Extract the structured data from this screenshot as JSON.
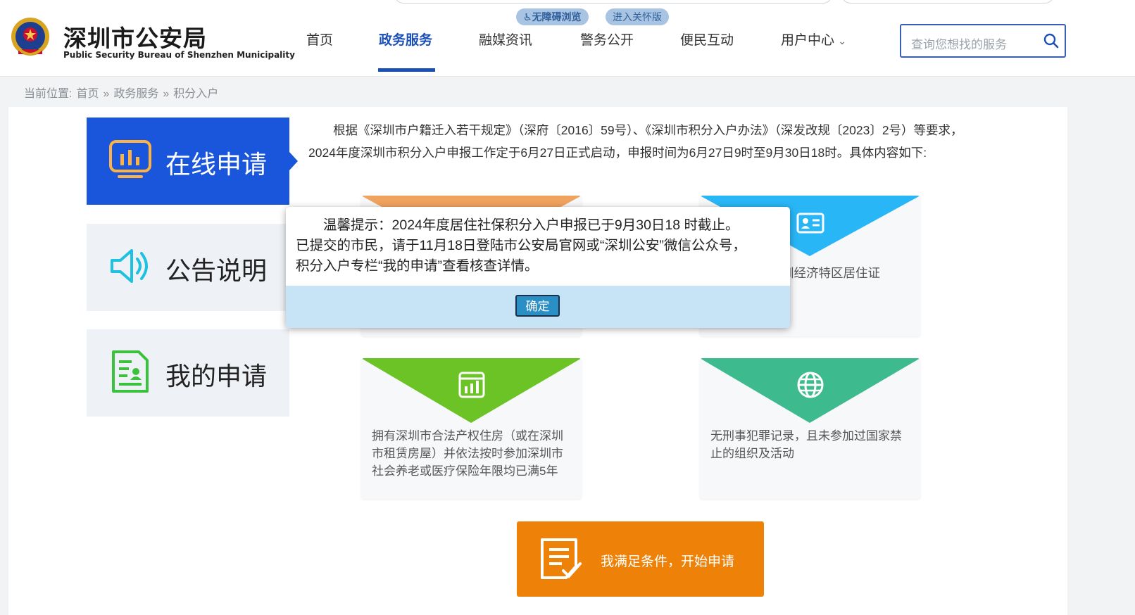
{
  "header": {
    "site_title": "深圳市公安局",
    "site_subtitle": "Public Security Bureau of Shenzhen Municipality",
    "accessibility_button": "无障碍浏览",
    "elderly_button": "进入关怀版",
    "nav": [
      "首页",
      "政务服务",
      "融媒资讯",
      "警务公开",
      "便民互动",
      "用户中心"
    ],
    "active_nav": "政务服务",
    "search_placeholder": "查询您想找的服务"
  },
  "breadcrumb": {
    "prefix": "当前位置:",
    "items": [
      "首页",
      "政务服务",
      "积分入户"
    ],
    "separator": "»"
  },
  "sidebar": {
    "items": [
      {
        "label": "在线申请",
        "icon": "monitor-chart-icon",
        "active": true
      },
      {
        "label": "公告说明",
        "icon": "speaker-icon",
        "active": false
      },
      {
        "label": "我的申请",
        "icon": "document-person-icon",
        "active": false
      }
    ]
  },
  "intro_text": "根据《深圳市户籍迁入若干规定》（深府〔2016〕59号）、《深圳市积分入户办法》（深发改规〔2023〕2号）等要求，2024年度深圳市积分入户申报工作定于6月27日正式启动，申报时间为6月27日9时至9月30日18时。具体内容如下:",
  "cards": [
    {
      "icon": "unknown-icon",
      "text": "",
      "color": "#f0a35e"
    },
    {
      "icon": "id-card-icon",
      "text": "圳经济特区居住证",
      "color": "#29b6f6"
    },
    {
      "icon": "building-chart-icon",
      "text": "拥有深圳市合法产权住房（或在深圳市租赁房屋）并依法按时参加深圳市社会养老或医疗保险年限均已满5年",
      "color": "#6cc326"
    },
    {
      "icon": "globe-icon",
      "text": "无刑事犯罪记录，且未参加过国家禁止的组织及活动",
      "color": "#3dbb8e"
    }
  ],
  "apply_button": "我满足条件，开始申请",
  "modal": {
    "line1": "温馨提示：2024年度居住社保积分入户申报已于9月30日18 时截止。",
    "line2": "已提交的市民，请于11月18日登陆市公安局官网或“深圳公安”微信公众号，",
    "line3": "积分入户专栏“我的申请”查看核查详情。",
    "ok_label": "确定"
  },
  "colors": {
    "brand_blue": "#1a56db",
    "nav_active": "#1a4fb7",
    "apply_orange": "#ee8208",
    "modal_footer": "#c6e4f6"
  }
}
